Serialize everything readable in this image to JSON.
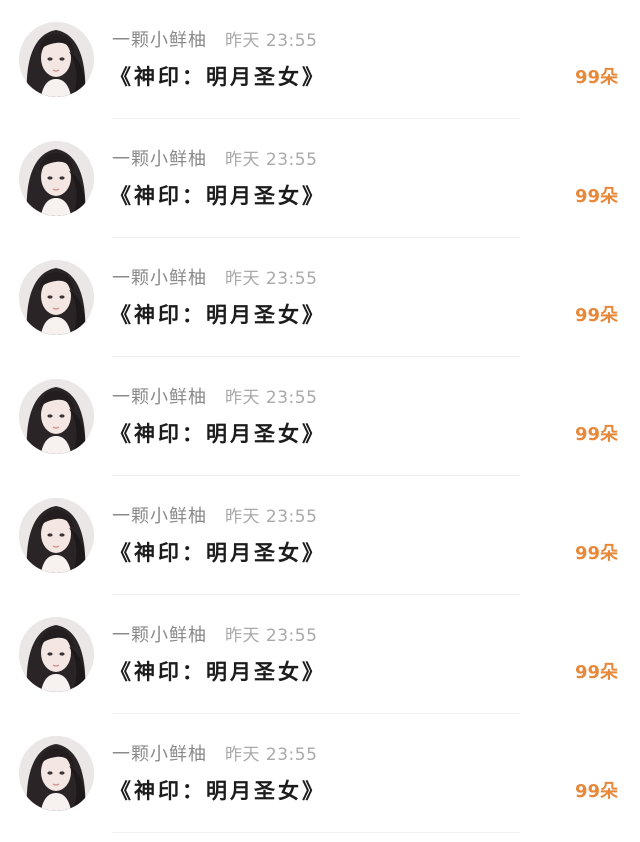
{
  "messages": [
    {
      "username": "一颗小鲜柚",
      "time": "昨天 23:55",
      "gift": "《神印：明月圣女》",
      "amount": "99朵",
      "avatar_icon": "user-avatar"
    },
    {
      "username": "一颗小鲜柚",
      "time": "昨天 23:55",
      "gift": "《神印：明月圣女》",
      "amount": "99朵",
      "avatar_icon": "user-avatar"
    },
    {
      "username": "一颗小鲜柚",
      "time": "昨天 23:55",
      "gift": "《神印：明月圣女》",
      "amount": "99朵",
      "avatar_icon": "user-avatar"
    },
    {
      "username": "一颗小鲜柚",
      "time": "昨天 23:55",
      "gift": "《神印：明月圣女》",
      "amount": "99朵",
      "avatar_icon": "user-avatar"
    },
    {
      "username": "一颗小鲜柚",
      "time": "昨天 23:55",
      "gift": "《神印：明月圣女》",
      "amount": "99朵",
      "avatar_icon": "user-avatar"
    },
    {
      "username": "一颗小鲜柚",
      "time": "昨天 23:55",
      "gift": "《神印：明月圣女》",
      "amount": "99朵",
      "avatar_icon": "user-avatar"
    },
    {
      "username": "一颗小鲜柚",
      "time": "昨天 23:55",
      "gift": "《神印：明月圣女》",
      "amount": "99朵",
      "avatar_icon": "user-avatar"
    }
  ],
  "colors": {
    "username": "#8a8a8a",
    "time": "#a9a9a9",
    "gift_title": "#1c1c1c",
    "amount_accent": "#e8883a",
    "divider": "#f0f0f0"
  }
}
